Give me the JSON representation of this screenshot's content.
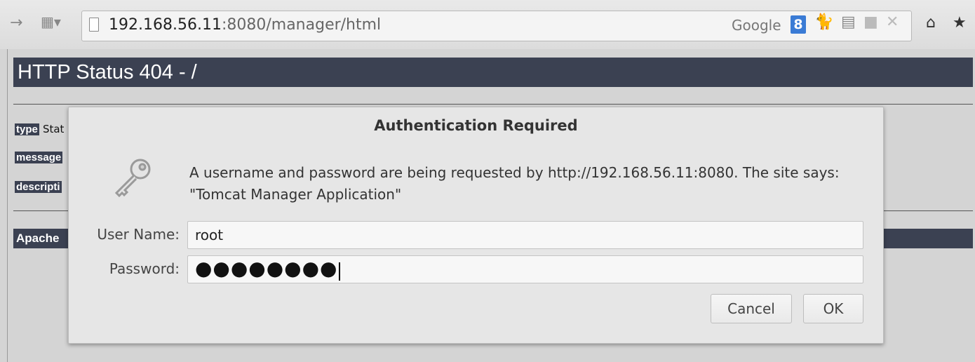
{
  "browser": {
    "url_host": "192.168.56.11",
    "url_path": ":8080/manager/html",
    "search_engine": "Google",
    "search_badge": "8"
  },
  "page": {
    "heading": "HTTP Status 404 - /",
    "type_label": "type",
    "type_value": "Stat",
    "message_label": "message",
    "description_label": "descripti",
    "footer_label": "Apache"
  },
  "dialog": {
    "title": "Authentication Required",
    "message": "A username and password are being requested by http://192.168.56.11:8080. The site says: \"Tomcat Manager Application\"",
    "username_label": "User Name:",
    "username_value": "root",
    "password_label": "Password:",
    "password_mask": "●●●●●●●●",
    "cancel_label": "Cancel",
    "ok_label": "OK"
  },
  "colors": {
    "header_bar": "#3b4152",
    "google_badge": "#3a7bd5"
  }
}
